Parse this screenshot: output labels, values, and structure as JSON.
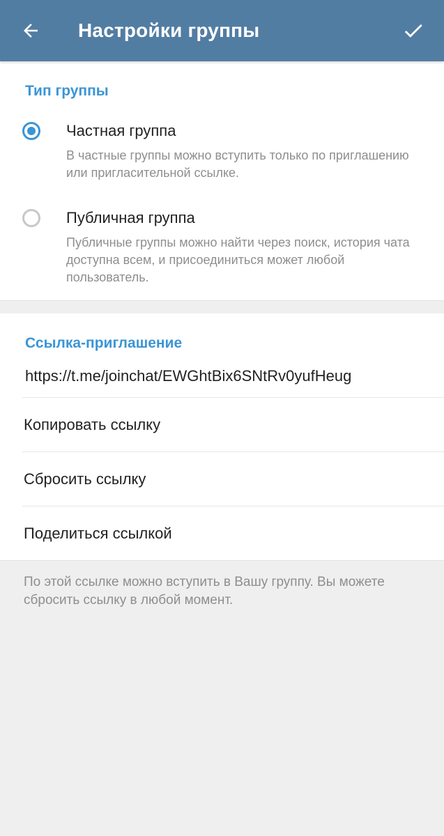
{
  "header": {
    "title": "Настройки группы",
    "back_icon": "arrow-left-icon",
    "done_icon": "check-icon",
    "background_color": "#527da3"
  },
  "group_type": {
    "section_title": "Тип группы",
    "options": [
      {
        "label": "Частная группа",
        "description": "В частные группы можно вступить только по приглашению или пригласительной ссылке.",
        "selected": true
      },
      {
        "label": "Публичная группа",
        "description": "Публичные группы можно найти через поиск, история чата доступна всем, и присоединиться может любой пользователь.",
        "selected": false
      }
    ]
  },
  "invite": {
    "section_title": "Ссылка-приглашение",
    "link": "https://t.me/joinchat/EWGhtBix6SNtRv0yufHeug",
    "actions": [
      "Копировать ссылку",
      "Сбросить ссылку",
      "Поделиться ссылкой"
    ],
    "note": "По этой ссылке можно вступить в Вашу группу. Вы можете сбросить ссылку в любой момент."
  },
  "colors": {
    "accent": "#3a95d5",
    "secondary_text": "#8e8e8e"
  }
}
